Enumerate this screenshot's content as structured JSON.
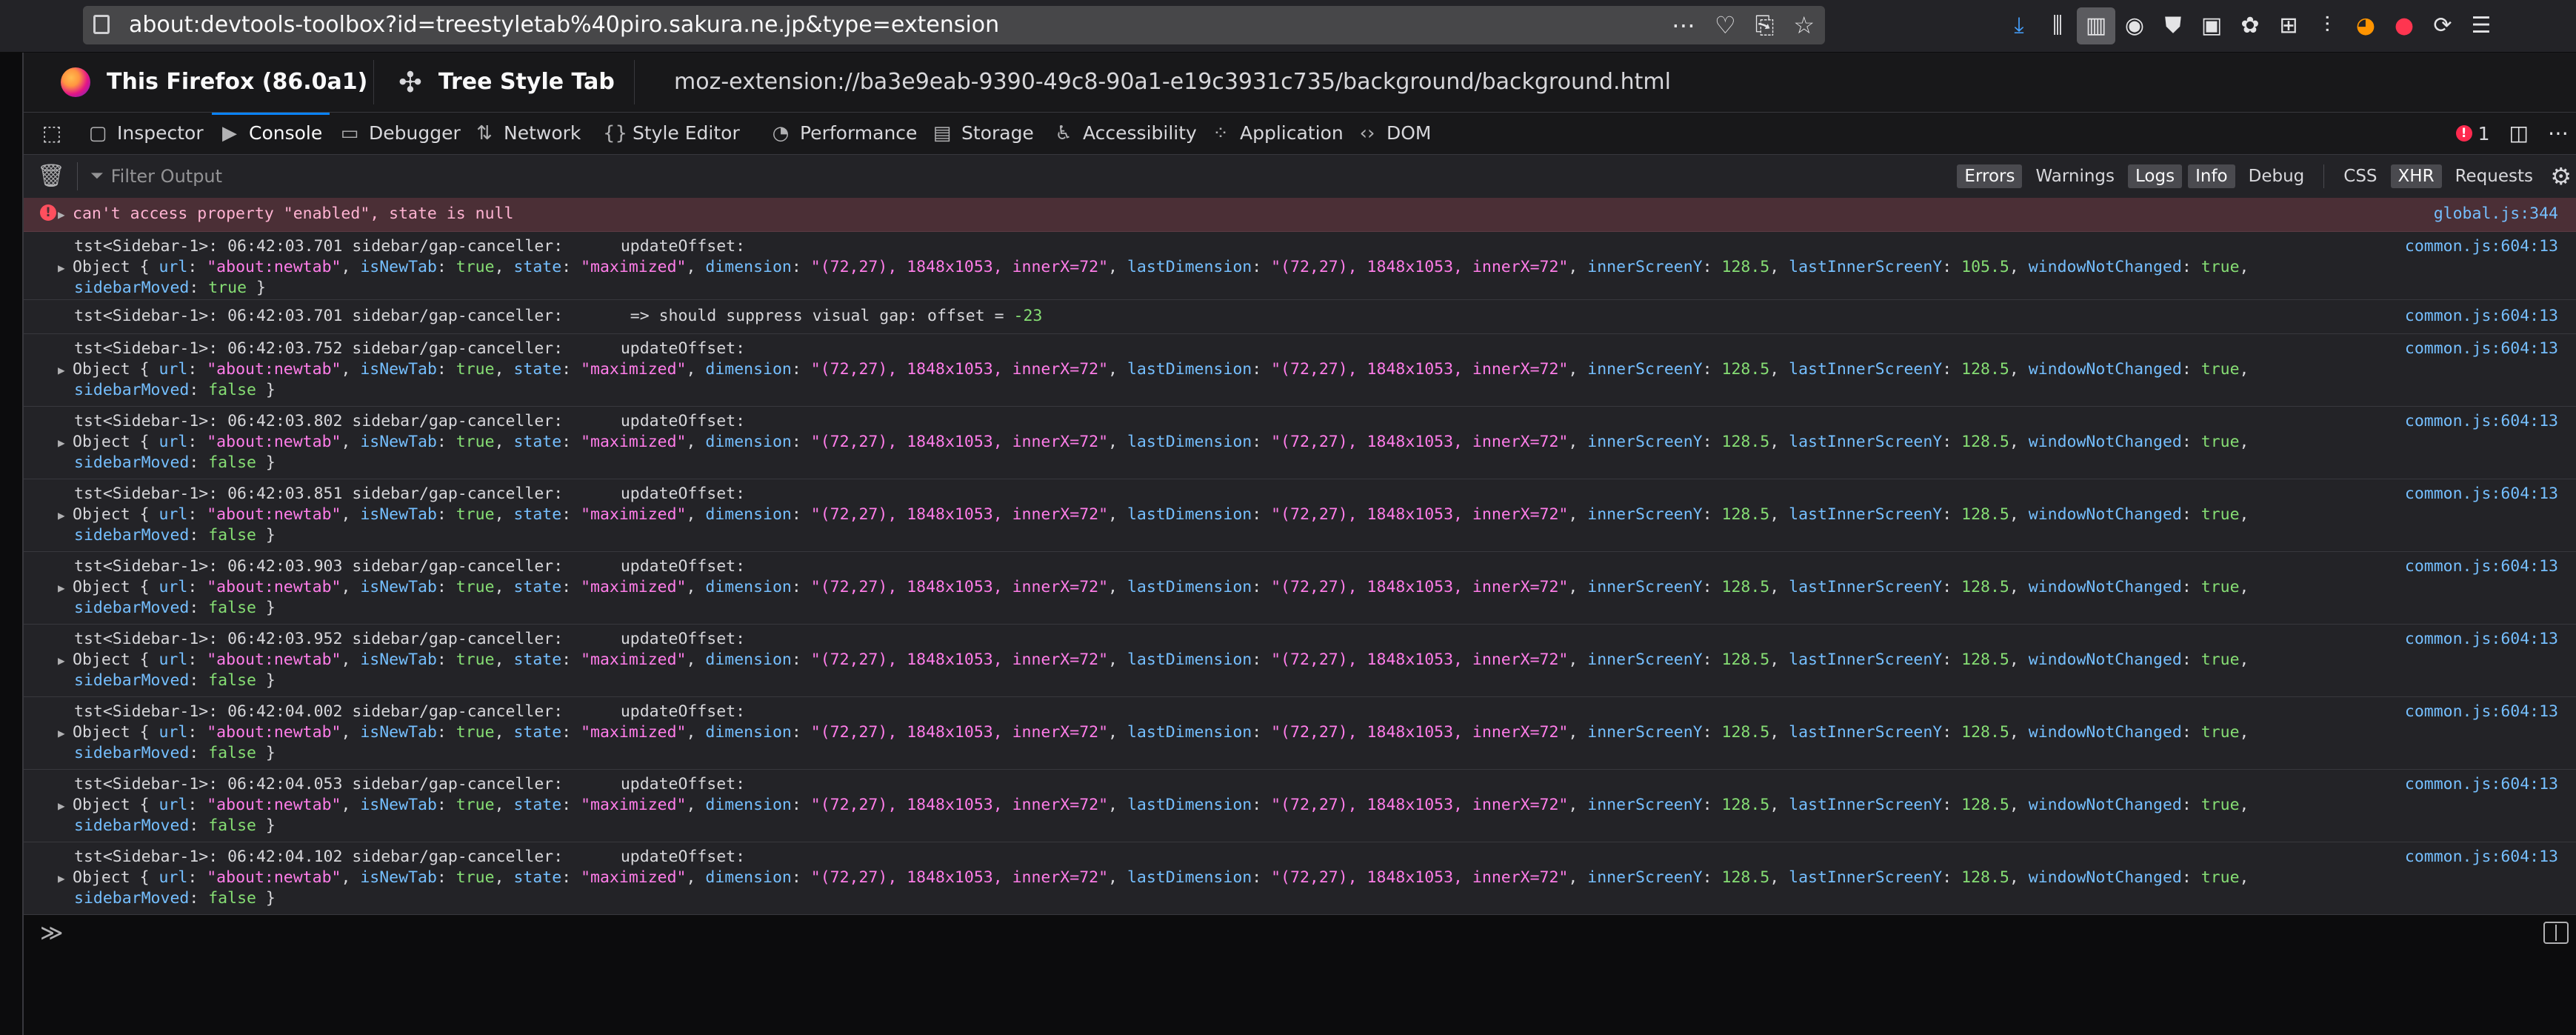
{
  "browser": {
    "url": "about:devtools-toolbox?id=treestyletab%40piro.sakura.ne.jp&type=extension",
    "url_actions": [
      "more-icon",
      "pocket-icon",
      "reader-icon",
      "bookmark-star-icon"
    ],
    "toolbar_icons": [
      "download-icon",
      "library-icon",
      "sidebar-icon",
      "account-icon",
      "ublock-icon",
      "container-icon",
      "extension-icon",
      "extensions-grid-icon",
      "settings-icon",
      "addon-orange-icon",
      "addon-red-icon",
      "sync-icon",
      "menu-icon"
    ]
  },
  "target": {
    "runtime_label": "This Firefox (86.0a1)",
    "extension_label": "Tree Style Tab",
    "page_url": "moz-extension://ba3e9eab-9390-49c8-90a1-e19c3931c735/background/background.html"
  },
  "tabs": [
    {
      "label": "Inspector",
      "icon": "inspector-icon"
    },
    {
      "label": "Console",
      "icon": "console-icon",
      "selected": true
    },
    {
      "label": "Debugger",
      "icon": "debugger-icon"
    },
    {
      "label": "Network",
      "icon": "network-icon"
    },
    {
      "label": "Style Editor",
      "icon": "style-editor-icon"
    },
    {
      "label": "Performance",
      "icon": "performance-icon"
    },
    {
      "label": "Storage",
      "icon": "storage-icon"
    },
    {
      "label": "Accessibility",
      "icon": "accessibility-icon"
    },
    {
      "label": "Application",
      "icon": "application-icon"
    },
    {
      "label": "DOM",
      "icon": "dom-icon"
    }
  ],
  "error_count": "1",
  "filter": {
    "placeholder": "Filter Output",
    "levels": [
      {
        "label": "Errors",
        "on": true
      },
      {
        "label": "Warnings",
        "on": false
      },
      {
        "label": "Logs",
        "on": true
      },
      {
        "label": "Info",
        "on": true
      },
      {
        "label": "Debug",
        "on": false
      }
    ],
    "extra": [
      {
        "label": "CSS",
        "on": false
      },
      {
        "label": "XHR",
        "on": true
      },
      {
        "label": "Requests",
        "on": false
      }
    ]
  },
  "messages": [
    {
      "type": "error",
      "text": "can't access property \"enabled\", state is null",
      "location": "global.js:344"
    },
    {
      "type": "log",
      "prefix": "tst<Sidebar-1>: 06:42:03.701 sidebar/gap-canceller:      updateOffset:",
      "location": "common.js:604:13",
      "object": {
        "innerScreenY": "128.5",
        "lastInnerScreenY": "105.5",
        "windowNotChanged": "true",
        "sidebarMoved": "true"
      },
      "wrap": "sidebarMoved: true }"
    },
    {
      "type": "plain",
      "text": "tst<Sidebar-1>: 06:42:03.701 sidebar/gap-canceller:       => should suppress visual gap: offset = ",
      "value": "-23",
      "location": "common.js:604:13"
    },
    {
      "type": "log",
      "prefix": "tst<Sidebar-1>: 06:42:03.752 sidebar/gap-canceller:      updateOffset:",
      "location": "common.js:604:13",
      "object": {
        "innerScreenY": "128.5",
        "lastInnerScreenY": "128.5",
        "windowNotChanged": "true",
        "sidebarMoved": "false"
      }
    },
    {
      "type": "log",
      "prefix": "tst<Sidebar-1>: 06:42:03.802 sidebar/gap-canceller:      updateOffset:",
      "location": "common.js:604:13",
      "object": {
        "innerScreenY": "128.5",
        "lastInnerScreenY": "128.5",
        "windowNotChanged": "true",
        "sidebarMoved": "false"
      }
    },
    {
      "type": "log",
      "prefix": "tst<Sidebar-1>: 06:42:03.851 sidebar/gap-canceller:      updateOffset:",
      "location": "common.js:604:13",
      "object": {
        "innerScreenY": "128.5",
        "lastInnerScreenY": "128.5",
        "windowNotChanged": "true",
        "sidebarMoved": "false"
      }
    },
    {
      "type": "log",
      "prefix": "tst<Sidebar-1>: 06:42:03.903 sidebar/gap-canceller:      updateOffset:",
      "location": "common.js:604:13",
      "object": {
        "innerScreenY": "128.5",
        "lastInnerScreenY": "128.5",
        "windowNotChanged": "true",
        "sidebarMoved": "false"
      }
    },
    {
      "type": "log",
      "prefix": "tst<Sidebar-1>: 06:42:03.952 sidebar/gap-canceller:      updateOffset:",
      "location": "common.js:604:13",
      "object": {
        "innerScreenY": "128.5",
        "lastInnerScreenY": "128.5",
        "windowNotChanged": "true",
        "sidebarMoved": "false"
      }
    },
    {
      "type": "log",
      "prefix": "tst<Sidebar-1>: 06:42:04.002 sidebar/gap-canceller:      updateOffset:",
      "location": "common.js:604:13",
      "object": {
        "innerScreenY": "128.5",
        "lastInnerScreenY": "128.5",
        "windowNotChanged": "true",
        "sidebarMoved": "false"
      }
    },
    {
      "type": "log",
      "prefix": "tst<Sidebar-1>: 06:42:04.053 sidebar/gap-canceller:      updateOffset:",
      "location": "common.js:604:13",
      "object": {
        "innerScreenY": "128.5",
        "lastInnerScreenY": "128.5",
        "windowNotChanged": "true",
        "sidebarMoved": "false"
      }
    },
    {
      "type": "log",
      "prefix": "tst<Sidebar-1>: 06:42:04.102 sidebar/gap-canceller:      updateOffset:",
      "location": "common.js:604:13",
      "object": {
        "innerScreenY": "128.5",
        "lastInnerScreenY": "128.5",
        "windowNotChanged": "true",
        "sidebarMoved": "false"
      }
    }
  ],
  "object_common": {
    "url": "\"about:newtab\"",
    "isNewTab": "true",
    "state": "\"maximized\"",
    "dimension": "\"(72,27), 1848x1053, innerX=72\"",
    "lastDimension": "\"(72,27), 1848x1053, innerX=72\""
  },
  "input_prompt": "≫",
  "colors": {
    "accent": "#0a84ff",
    "error_bg": "#4b2f36",
    "key": "#75bfff",
    "string": "#ff7de9",
    "bool": "#86de74"
  }
}
